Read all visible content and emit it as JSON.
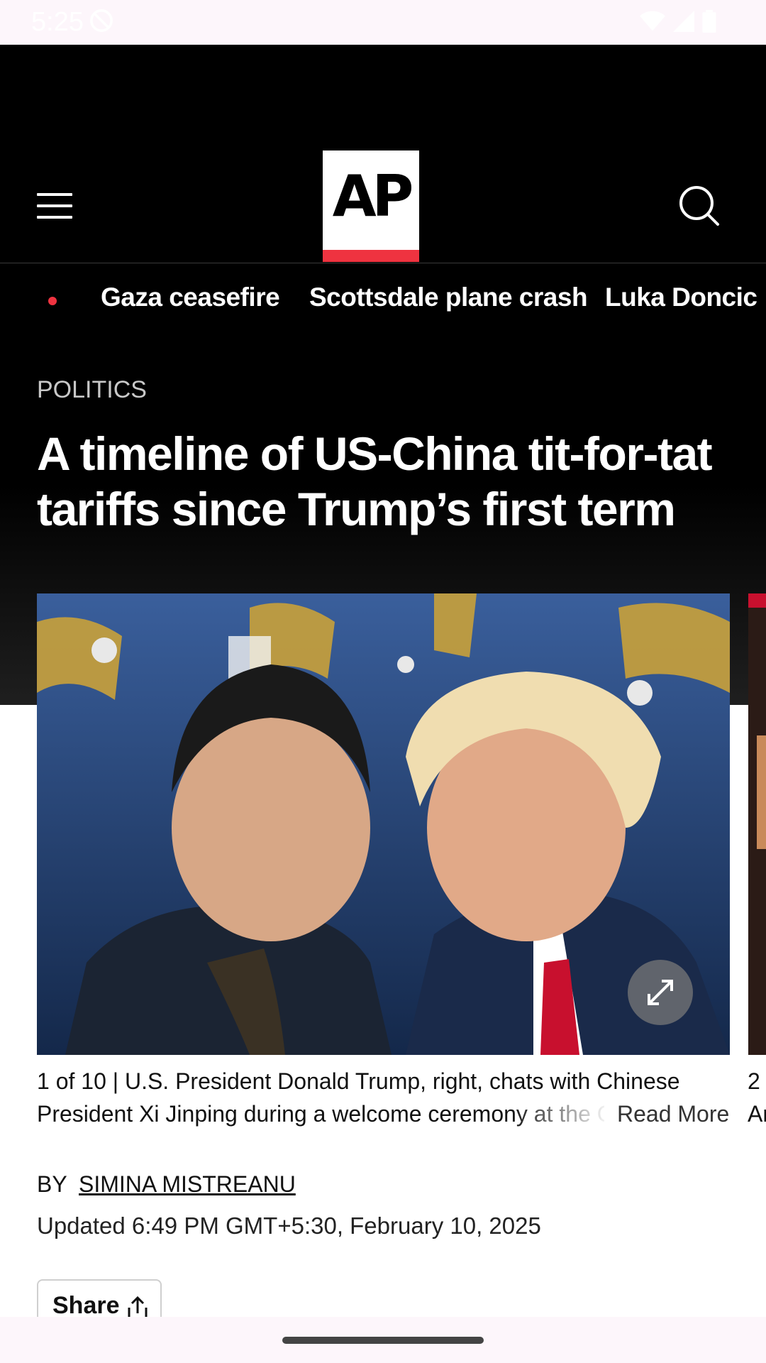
{
  "status_bar": {
    "time": "5:25"
  },
  "header": {
    "logo_text": "AP"
  },
  "trending": {
    "items": [
      "Gaza ceasefire",
      "Scottsdale plane crash",
      "Luka Doncic"
    ]
  },
  "article": {
    "section": "POLITICS",
    "headline_line1": "A timeline of US-China tit-for-tat",
    "headline_line2": "tariffs since Trump’s first term",
    "gallery": {
      "counter": "1 of 10 |",
      "caption_line1": "U.S. President Donald Trump, right, chats with Chinese",
      "caption_line2": "President Xi Jinping during a welcome ceremony at the Gr",
      "read_more": "Read More",
      "next_counter": "2",
      "next_caption": "Ar"
    },
    "byline_prefix": "BY",
    "author": "SIMINA MISTREANU",
    "updated": "Updated 6:49 PM GMT+5:30, February 10, 2025",
    "share_label": "Share"
  },
  "colors": {
    "brand_red": "#ef3340",
    "header_bg": "#000000"
  }
}
